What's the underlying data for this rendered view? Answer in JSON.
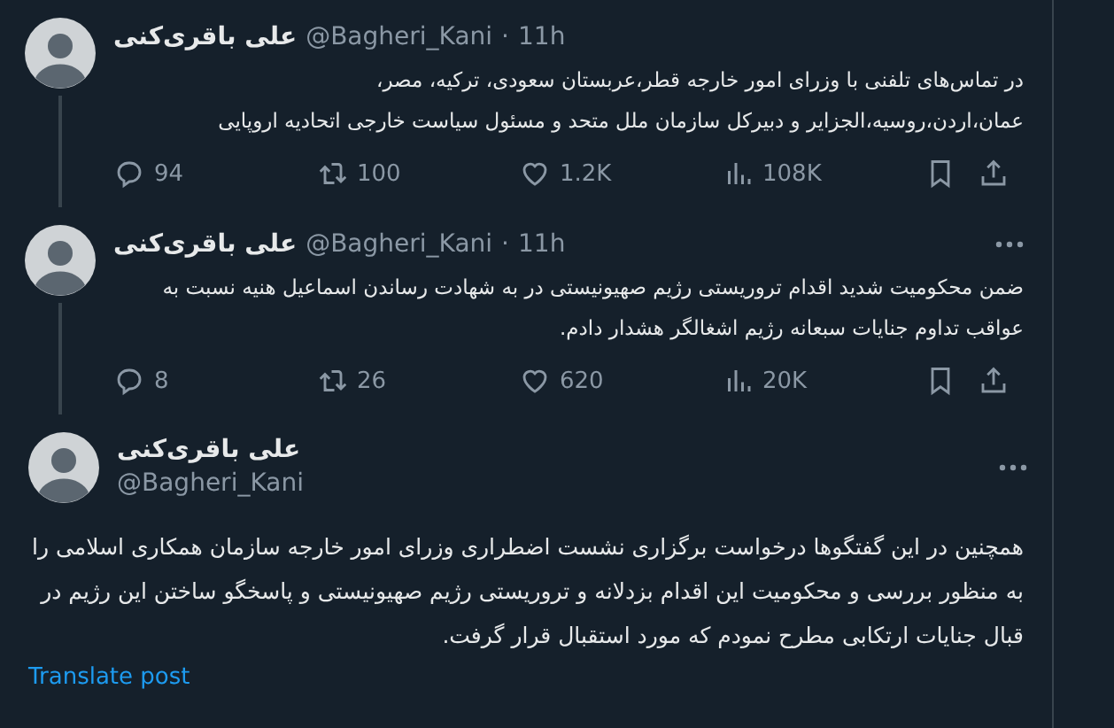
{
  "tweets": [
    {
      "kind": "reply",
      "show_menu": false,
      "author": {
        "name": "علی باقری‌کنی",
        "handle": "@Bagheri_Kani",
        "separator": "·",
        "time": "11h"
      },
      "text": "در تماس‌های تلفنی با وزرای امور خارجه قطر،عربستان سعودی، ترکیه، مصر،\nعمان،اردن،روسیه،الجزایر و دبیرکل سازمان ملل متحد و مسئول سیاست خارجی اتحادیه اروپایی",
      "stats": {
        "replies": "94",
        "reposts": "100",
        "likes": "1.2K",
        "views": "108K"
      }
    },
    {
      "kind": "reply",
      "show_menu": true,
      "author": {
        "name": "علی باقری‌کنی",
        "handle": "@Bagheri_Kani",
        "separator": "·",
        "time": "11h"
      },
      "text": "ضمن محکومیت شدید اقدام تروریستی رژیم صهیونیستی در به شهادت رساندن اسماعیل هنیه نسبت به\nعواقب تداوم جنایات سبعانه رژیم اشغالگر هشدار دادم.",
      "stats": {
        "replies": "8",
        "reposts": "26",
        "likes": "620",
        "views": "20K"
      }
    },
    {
      "kind": "focused",
      "show_menu": true,
      "author": {
        "name": "علی باقری‌کنی",
        "handle": "@Bagheri_Kani"
      },
      "text": "همچنین در این گفتگوها درخواست برگزاری نشست اضطراری وزرای امور خارجه سازمان همکاری اسلامی را به منظور بررسی و محکومیت این اقدام بزدلانه و تروریستی رژیم صهیونیستی و پاسخگو ساختن این رژیم در قبال جنایات ارتکابی مطرح نمودم که مورد استقبال قرار گرفت.",
      "translate": "Translate post"
    }
  ]
}
